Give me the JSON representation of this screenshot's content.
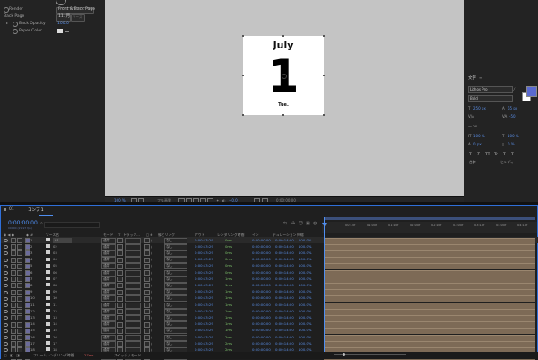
{
  "effect_panel": {
    "rows": [
      {
        "label": "Render",
        "value": "Front & Back Page"
      },
      {
        "label": "Back Page",
        "value": "11. 月"
      },
      {
        "label": "Back Opacity",
        "value": "100.0"
      },
      {
        "label": "Paper Color",
        "value": ""
      }
    ],
    "back_page_extra": "ソース"
  },
  "viewer": {
    "month": "July",
    "day": "1",
    "weekday": "Tue.",
    "zoom": "100 %",
    "resolution": "フル画質",
    "exposure": "+0.0",
    "timecode": "0:00:00:00"
  },
  "character_panel": {
    "tab": "文字",
    "font_family": "Lithos Pro",
    "font_style": "Bold",
    "font_size": "250 px",
    "leading": "65 px",
    "tracking_label": "VA",
    "tracking_value": "-50",
    "stroke_label": "— px",
    "vert_scale": "100 %",
    "horiz_scale": "100 %",
    "baseline": "0 px",
    "tsume": "0 %",
    "typo": [
      "T",
      "T",
      "TT",
      "Tr",
      "T",
      "T",
      "T",
      "T"
    ],
    "ligature": "合字",
    "hindi": "ヒンディー"
  },
  "timeline": {
    "tabs": [
      "01",
      "コンプ 1"
    ],
    "current_time": "0:00:00:00",
    "current_sub": "00000 (29.97 fps)",
    "headers": {
      "num": "#",
      "source": "ソース名",
      "mode": "モード",
      "t": "T",
      "trkmat": "トラック...",
      "parent": "親とリンク",
      "out": "アウト",
      "render_time": "レンダリング時間",
      "in": "イン",
      "duration": "デュレーション",
      "stretch": "伸縮"
    },
    "ruler_ticks": [
      "0f",
      "00:15f",
      "01:00f",
      "01:15f",
      "02:00f",
      "02:15f",
      "03:00f",
      "03:15f",
      "04:00f",
      "04:15f"
    ],
    "layers": [
      {
        "num": "1",
        "name": "01",
        "mode": "通常",
        "parent": "なし",
        "out": "0:00:13:29",
        "render": "0ms",
        "in": "0:00:00:00",
        "dur": "0:00:14:00",
        "stretch": "100.0%"
      },
      {
        "num": "2",
        "name": "02",
        "mode": "通常",
        "parent": "なし",
        "out": "0:00:13:29",
        "render": "0ms",
        "in": "0:00:00:00",
        "dur": "0:00:14:00",
        "stretch": "100.0%"
      },
      {
        "num": "3",
        "name": "03",
        "mode": "通常",
        "parent": "なし",
        "out": "0:00:13:29",
        "render": "0ms",
        "in": "0:00:00:00",
        "dur": "0:00:14:00",
        "stretch": "100.0%"
      },
      {
        "num": "4",
        "name": "04",
        "mode": "通常",
        "parent": "なし",
        "out": "0:00:13:29",
        "render": "0ms",
        "in": "0:00:00:00",
        "dur": "0:00:14:00",
        "stretch": "100.0%"
      },
      {
        "num": "5",
        "name": "05",
        "mode": "通常",
        "parent": "なし",
        "out": "0:00:13:29",
        "render": "0ms",
        "in": "0:00:00:00",
        "dur": "0:00:14:00",
        "stretch": "100.0%"
      },
      {
        "num": "6",
        "name": "06",
        "mode": "通常",
        "parent": "なし",
        "out": "0:00:13:29",
        "render": "0ms",
        "in": "0:00:00:00",
        "dur": "0:00:14:00",
        "stretch": "100.0%"
      },
      {
        "num": "7",
        "name": "07",
        "mode": "通常",
        "parent": "なし",
        "out": "0:00:13:29",
        "render": "1ms",
        "in": "0:00:00:00",
        "dur": "0:00:14:00",
        "stretch": "100.0%"
      },
      {
        "num": "8",
        "name": "08",
        "mode": "通常",
        "parent": "なし",
        "out": "0:00:13:29",
        "render": "1ms",
        "in": "0:00:00:00",
        "dur": "0:00:14:00",
        "stretch": "100.0%"
      },
      {
        "num": "9",
        "name": "09",
        "mode": "通常",
        "parent": "なし",
        "out": "0:00:13:29",
        "render": "1ms",
        "in": "0:00:00:00",
        "dur": "0:00:14:00",
        "stretch": "100.0%"
      },
      {
        "num": "10",
        "name": "10",
        "mode": "通常",
        "parent": "なし",
        "out": "0:00:13:29",
        "render": "1ms",
        "in": "0:00:00:00",
        "dur": "0:00:14:00",
        "stretch": "100.0%"
      },
      {
        "num": "11",
        "name": "11",
        "mode": "通常",
        "parent": "なし",
        "out": "0:00:13:29",
        "render": "1ms",
        "in": "0:00:00:00",
        "dur": "0:00:14:00",
        "stretch": "100.0%"
      },
      {
        "num": "12",
        "name": "12",
        "mode": "通常",
        "parent": "なし",
        "out": "0:00:13:29",
        "render": "1ms",
        "in": "0:00:00:00",
        "dur": "0:00:14:00",
        "stretch": "100.0%"
      },
      {
        "num": "13",
        "name": "13",
        "mode": "通常",
        "parent": "なし",
        "out": "0:00:13:29",
        "render": "1ms",
        "in": "0:00:00:00",
        "dur": "0:00:14:00",
        "stretch": "100.0%"
      },
      {
        "num": "14",
        "name": "14",
        "mode": "通常",
        "parent": "なし",
        "out": "0:00:13:29",
        "render": "1ms",
        "in": "0:00:00:00",
        "dur": "0:00:14:00",
        "stretch": "100.0%"
      },
      {
        "num": "15",
        "name": "15",
        "mode": "通常",
        "parent": "なし",
        "out": "0:00:13:29",
        "render": "1ms",
        "in": "0:00:00:00",
        "dur": "0:00:14:00",
        "stretch": "100.0%"
      },
      {
        "num": "16",
        "name": "16",
        "mode": "通常",
        "parent": "なし",
        "out": "0:00:13:29",
        "render": "2ms",
        "in": "0:00:00:00",
        "dur": "0:00:14:00",
        "stretch": "100.0%"
      },
      {
        "num": "17",
        "name": "17",
        "mode": "通常",
        "parent": "なし",
        "out": "0:00:13:29",
        "render": "2ms",
        "in": "0:00:00:00",
        "dur": "0:00:14:00",
        "stretch": "100.0%"
      },
      {
        "num": "18",
        "name": "18",
        "mode": "通常",
        "parent": "なし",
        "out": "0:00:13:29",
        "render": "2ms",
        "in": "0:00:00:00",
        "dur": "0:00:14:00",
        "stretch": "100.0%"
      },
      {
        "num": "19",
        "name": "19",
        "mode": "通常",
        "parent": "なし",
        "out": "0:00:13:29",
        "render": "2ms",
        "in": "0:00:00:00",
        "dur": "0:00:14:00",
        "stretch": "100.0%"
      }
    ],
    "status": {
      "frame_render_label": "フレームレンダリング時間",
      "frame_render_value": "27ms",
      "switch_mode": "スイッチ / モード"
    }
  },
  "colors": {
    "accent": "#4f8ef0",
    "layer_bar": "#7d6a56",
    "font_color": "#5a6ad0"
  }
}
